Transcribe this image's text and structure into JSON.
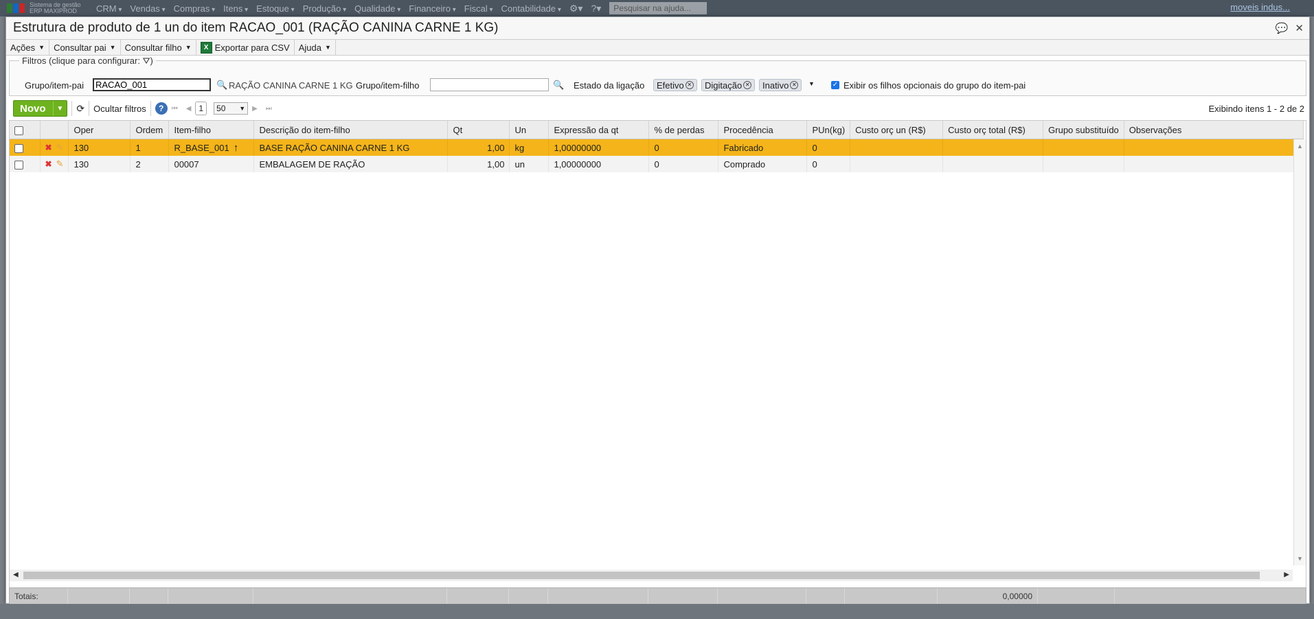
{
  "topnav": {
    "logo_line1": "Sistema de gestão",
    "logo_line2": "ERP MAXIPROD",
    "items": [
      "CRM",
      "Vendas",
      "Compras",
      "Itens",
      "Estoque",
      "Produção",
      "Qualidade",
      "Financeiro",
      "Fiscal",
      "Contabilidade"
    ],
    "search_placeholder": "Pesquisar na ajuda...",
    "user_link": "moveis indus..."
  },
  "window": {
    "title": "Estrutura de produto de 1 un do item RACAO_001 (RAÇÃO CANINA CARNE 1 KG)"
  },
  "menubar": {
    "acoes": "Ações",
    "consultar_pai": "Consultar pai",
    "consultar_filho": "Consultar filho",
    "exportar_csv": "Exportar para CSV",
    "ajuda": "Ajuda"
  },
  "filters": {
    "legend": "Filtros (clique para configurar:",
    "legend_close": ")",
    "pai_label": "Grupo/item-pai",
    "pai_value": "RACAO_001",
    "pai_description": "RAÇÃO CANINA CARNE 1 KG",
    "filho_label": "Grupo/item-filho",
    "filho_value": "",
    "estado_label": "Estado da ligação",
    "estado_tags": [
      "Efetivo",
      "Digitação",
      "Inativo"
    ],
    "opcionais_label": "Exibir os filhos opcionais do grupo do item-pai",
    "opcionais_checked": true
  },
  "toolbar": {
    "novo": "Novo",
    "ocultar_filtros": "Ocultar filtros",
    "page": "1",
    "page_size": "50",
    "exibindo": "Exibindo itens 1 - 2 de 2"
  },
  "grid": {
    "columns": [
      "Oper",
      "Ordem",
      "Item-filho",
      "Descrição do item-filho",
      "Qt",
      "Un",
      "Expressão da qt",
      "% de perdas",
      "Procedência",
      "PUn(kg)",
      "Custo orç un (R$)",
      "Custo orç total (R$)",
      "Grupo substituído",
      "Observações"
    ],
    "rows": [
      {
        "oper": "130",
        "ordem": "1",
        "item_filho": "R_BASE_001",
        "descricao": "BASE RAÇÃO CANINA CARNE 1 KG",
        "qt": "1,00",
        "un": "kg",
        "expressao": "1,00000000",
        "perdas": "0",
        "procedencia": "Fabricado",
        "pun": "0",
        "custo_un": "",
        "custo_total": "",
        "grupo_subst": "",
        "obs": ""
      },
      {
        "oper": "130",
        "ordem": "2",
        "item_filho": "00007",
        "descricao": "EMBALAGEM DE RAÇÃO",
        "qt": "1,00",
        "un": "un",
        "expressao": "1,00000000",
        "perdas": "0",
        "procedencia": "Comprado",
        "pun": "0",
        "custo_un": "",
        "custo_total": "",
        "grupo_subst": "",
        "obs": ""
      }
    ],
    "selected_row": 0
  },
  "totals": {
    "label": "Totais:",
    "custo_total": "0,00000"
  },
  "colors": {
    "selected_row": "#f4b41a",
    "novo_button": "#6eb31f",
    "topnav": "#4b5560"
  }
}
